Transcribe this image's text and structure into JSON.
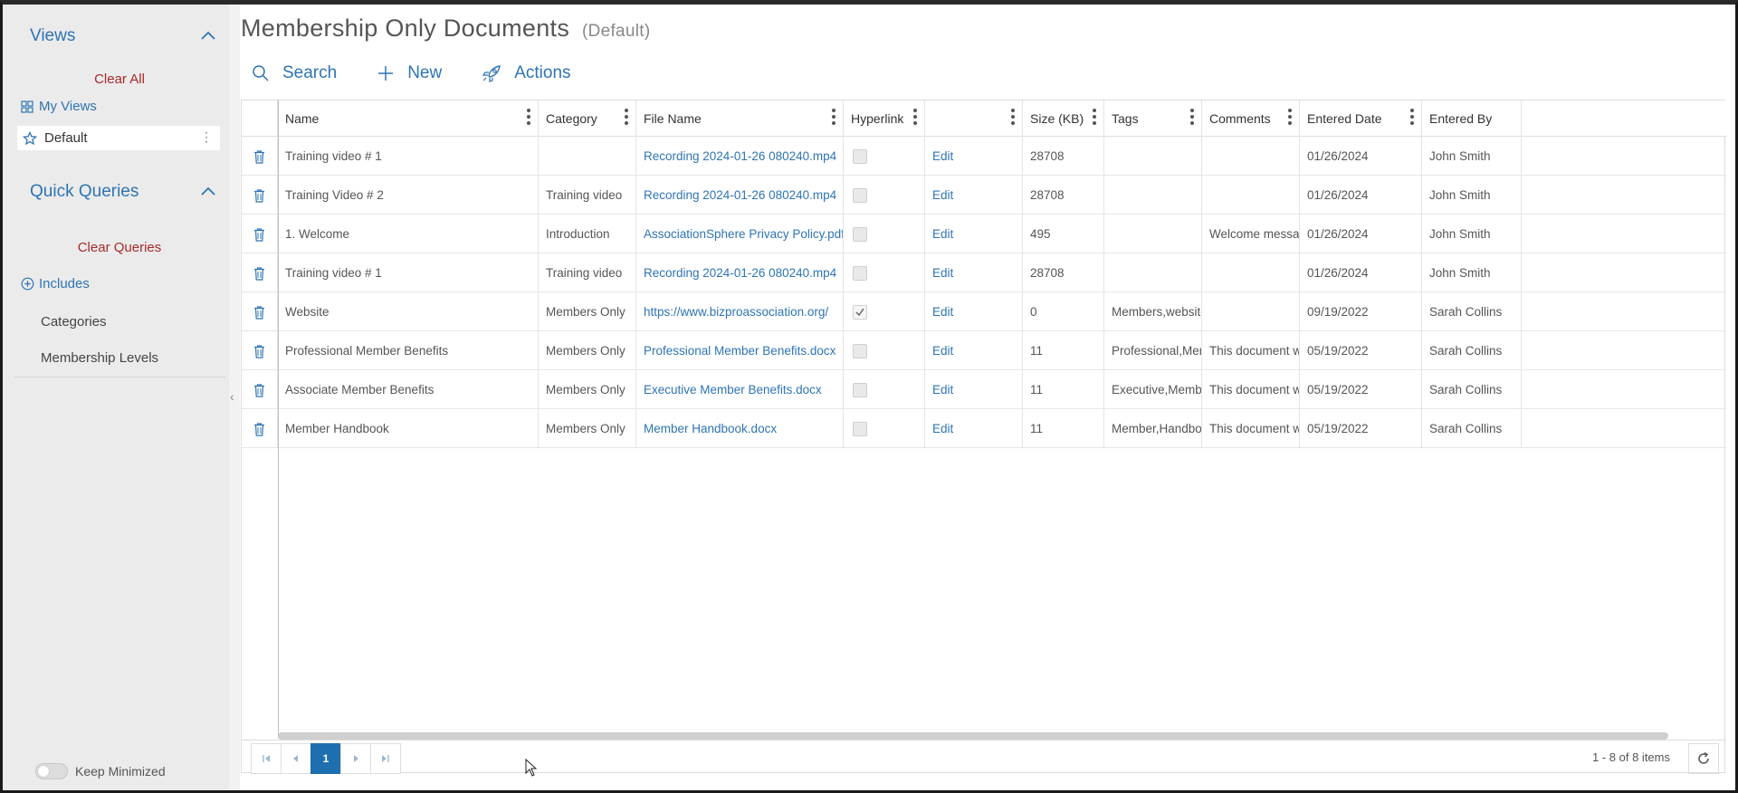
{
  "sidebar": {
    "views_title": "Views",
    "clear_all": "Clear All",
    "my_views": "My Views",
    "default_view": "Default",
    "quick_queries_title": "Quick Queries",
    "clear_queries": "Clear Queries",
    "includes": "Includes",
    "items": [
      "Categories",
      "Membership Levels"
    ],
    "keep_minimized": "Keep Minimized"
  },
  "page": {
    "title": "Membership Only Documents",
    "view_name": "(Default)"
  },
  "toolbar": {
    "search": "Search",
    "new": "New",
    "actions": "Actions"
  },
  "grid": {
    "columns": [
      "Name",
      "Category",
      "File Name",
      "Hyperlink",
      "",
      "Size (KB)",
      "Tags",
      "Comments",
      "Entered Date",
      "Entered By"
    ],
    "rows": [
      {
        "name": "Training video # 1",
        "category": "",
        "file": "Recording 2024-01-26 080240.mp4",
        "hyperlink": false,
        "edit": "Edit",
        "size": "28708",
        "tags": "",
        "comments": "",
        "date": "01/26/2024",
        "by": "John Smith"
      },
      {
        "name": "Training Video # 2",
        "category": "Training video",
        "file": "Recording 2024-01-26 080240.mp4",
        "hyperlink": false,
        "edit": "Edit",
        "size": "28708",
        "tags": "",
        "comments": "",
        "date": "01/26/2024",
        "by": "John Smith"
      },
      {
        "name": "1. Welcome",
        "category": "Introduction",
        "file": "AssociationSphere Privacy Policy.pdf",
        "hyperlink": false,
        "edit": "Edit",
        "size": "495",
        "tags": "",
        "comments": "Welcome messag...",
        "date": "01/26/2024",
        "by": "John Smith"
      },
      {
        "name": "Training video # 1",
        "category": "Training video",
        "file": "Recording 2024-01-26 080240.mp4",
        "hyperlink": false,
        "edit": "Edit",
        "size": "28708",
        "tags": "",
        "comments": "",
        "date": "01/26/2024",
        "by": "John Smith"
      },
      {
        "name": "Website",
        "category": "Members Only",
        "file": "https://www.bizproassociation.org/",
        "hyperlink": true,
        "edit": "Edit",
        "size": "0",
        "tags": "Members,website...",
        "comments": "",
        "date": "09/19/2022",
        "by": "Sarah Collins"
      },
      {
        "name": "Professional Member Benefits",
        "category": "Members Only",
        "file": "Professional Member Benefits.docx",
        "hyperlink": false,
        "edit": "Edit",
        "size": "11",
        "tags": "Professional,Mem...",
        "comments": "This document wi...",
        "date": "05/19/2022",
        "by": "Sarah Collins"
      },
      {
        "name": "Associate Member Benefits",
        "category": "Members Only",
        "file": "Executive Member Benefits.docx",
        "hyperlink": false,
        "edit": "Edit",
        "size": "11",
        "tags": "Executive,Member",
        "comments": "This document wi...",
        "date": "05/19/2022",
        "by": "Sarah Collins"
      },
      {
        "name": "Member Handbook",
        "category": "Members Only",
        "file": "Member Handbook.docx",
        "hyperlink": false,
        "edit": "Edit",
        "size": "11",
        "tags": "Member,Handbook",
        "comments": "This document wi...",
        "date": "05/19/2022",
        "by": "Sarah Collins"
      }
    ]
  },
  "pager": {
    "current_page": "1",
    "info": "1 - 8 of 8 items"
  },
  "colors": {
    "accent": "#2e74b5",
    "danger": "#a82a2a",
    "sidebar_bg": "#ebebeb",
    "page_active": "#1e6fb0"
  }
}
